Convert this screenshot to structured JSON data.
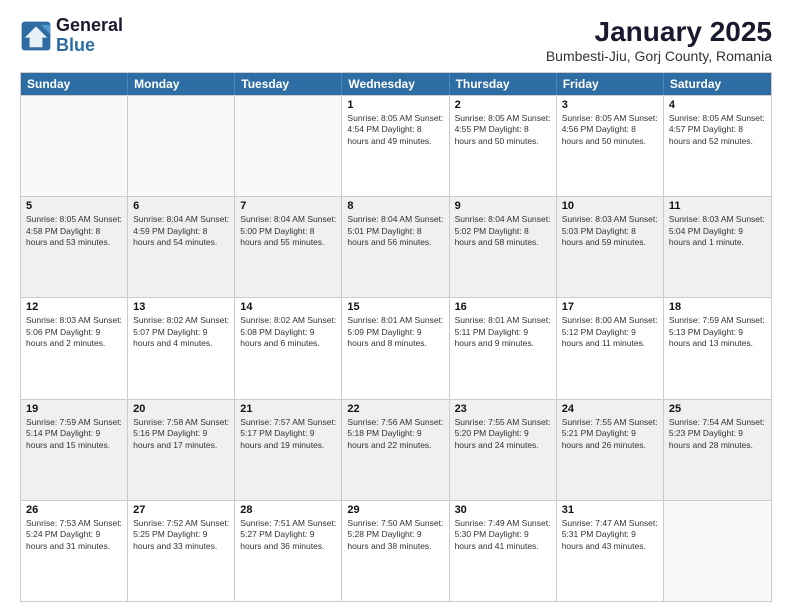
{
  "header": {
    "logo_line1": "General",
    "logo_line2": "Blue",
    "title": "January 2025",
    "subtitle": "Bumbesti-Jiu, Gorj County, Romania"
  },
  "weekdays": [
    "Sunday",
    "Monday",
    "Tuesday",
    "Wednesday",
    "Thursday",
    "Friday",
    "Saturday"
  ],
  "rows": [
    [
      {
        "day": "",
        "info": ""
      },
      {
        "day": "",
        "info": ""
      },
      {
        "day": "",
        "info": ""
      },
      {
        "day": "1",
        "info": "Sunrise: 8:05 AM\nSunset: 4:54 PM\nDaylight: 8 hours\nand 49 minutes."
      },
      {
        "day": "2",
        "info": "Sunrise: 8:05 AM\nSunset: 4:55 PM\nDaylight: 8 hours\nand 50 minutes."
      },
      {
        "day": "3",
        "info": "Sunrise: 8:05 AM\nSunset: 4:56 PM\nDaylight: 8 hours\nand 50 minutes."
      },
      {
        "day": "4",
        "info": "Sunrise: 8:05 AM\nSunset: 4:57 PM\nDaylight: 8 hours\nand 52 minutes."
      }
    ],
    [
      {
        "day": "5",
        "info": "Sunrise: 8:05 AM\nSunset: 4:58 PM\nDaylight: 8 hours\nand 53 minutes."
      },
      {
        "day": "6",
        "info": "Sunrise: 8:04 AM\nSunset: 4:59 PM\nDaylight: 8 hours\nand 54 minutes."
      },
      {
        "day": "7",
        "info": "Sunrise: 8:04 AM\nSunset: 5:00 PM\nDaylight: 8 hours\nand 55 minutes."
      },
      {
        "day": "8",
        "info": "Sunrise: 8:04 AM\nSunset: 5:01 PM\nDaylight: 8 hours\nand 56 minutes."
      },
      {
        "day": "9",
        "info": "Sunrise: 8:04 AM\nSunset: 5:02 PM\nDaylight: 8 hours\nand 58 minutes."
      },
      {
        "day": "10",
        "info": "Sunrise: 8:03 AM\nSunset: 5:03 PM\nDaylight: 8 hours\nand 59 minutes."
      },
      {
        "day": "11",
        "info": "Sunrise: 8:03 AM\nSunset: 5:04 PM\nDaylight: 9 hours\nand 1 minute."
      }
    ],
    [
      {
        "day": "12",
        "info": "Sunrise: 8:03 AM\nSunset: 5:06 PM\nDaylight: 9 hours\nand 2 minutes."
      },
      {
        "day": "13",
        "info": "Sunrise: 8:02 AM\nSunset: 5:07 PM\nDaylight: 9 hours\nand 4 minutes."
      },
      {
        "day": "14",
        "info": "Sunrise: 8:02 AM\nSunset: 5:08 PM\nDaylight: 9 hours\nand 6 minutes."
      },
      {
        "day": "15",
        "info": "Sunrise: 8:01 AM\nSunset: 5:09 PM\nDaylight: 9 hours\nand 8 minutes."
      },
      {
        "day": "16",
        "info": "Sunrise: 8:01 AM\nSunset: 5:11 PM\nDaylight: 9 hours\nand 9 minutes."
      },
      {
        "day": "17",
        "info": "Sunrise: 8:00 AM\nSunset: 5:12 PM\nDaylight: 9 hours\nand 11 minutes."
      },
      {
        "day": "18",
        "info": "Sunrise: 7:59 AM\nSunset: 5:13 PM\nDaylight: 9 hours\nand 13 minutes."
      }
    ],
    [
      {
        "day": "19",
        "info": "Sunrise: 7:59 AM\nSunset: 5:14 PM\nDaylight: 9 hours\nand 15 minutes."
      },
      {
        "day": "20",
        "info": "Sunrise: 7:58 AM\nSunset: 5:16 PM\nDaylight: 9 hours\nand 17 minutes."
      },
      {
        "day": "21",
        "info": "Sunrise: 7:57 AM\nSunset: 5:17 PM\nDaylight: 9 hours\nand 19 minutes."
      },
      {
        "day": "22",
        "info": "Sunrise: 7:56 AM\nSunset: 5:18 PM\nDaylight: 9 hours\nand 22 minutes."
      },
      {
        "day": "23",
        "info": "Sunrise: 7:55 AM\nSunset: 5:20 PM\nDaylight: 9 hours\nand 24 minutes."
      },
      {
        "day": "24",
        "info": "Sunrise: 7:55 AM\nSunset: 5:21 PM\nDaylight: 9 hours\nand 26 minutes."
      },
      {
        "day": "25",
        "info": "Sunrise: 7:54 AM\nSunset: 5:23 PM\nDaylight: 9 hours\nand 28 minutes."
      }
    ],
    [
      {
        "day": "26",
        "info": "Sunrise: 7:53 AM\nSunset: 5:24 PM\nDaylight: 9 hours\nand 31 minutes."
      },
      {
        "day": "27",
        "info": "Sunrise: 7:52 AM\nSunset: 5:25 PM\nDaylight: 9 hours\nand 33 minutes."
      },
      {
        "day": "28",
        "info": "Sunrise: 7:51 AM\nSunset: 5:27 PM\nDaylight: 9 hours\nand 36 minutes."
      },
      {
        "day": "29",
        "info": "Sunrise: 7:50 AM\nSunset: 5:28 PM\nDaylight: 9 hours\nand 38 minutes."
      },
      {
        "day": "30",
        "info": "Sunrise: 7:49 AM\nSunset: 5:30 PM\nDaylight: 9 hours\nand 41 minutes."
      },
      {
        "day": "31",
        "info": "Sunrise: 7:47 AM\nSunset: 5:31 PM\nDaylight: 9 hours\nand 43 minutes."
      },
      {
        "day": "",
        "info": ""
      }
    ]
  ]
}
